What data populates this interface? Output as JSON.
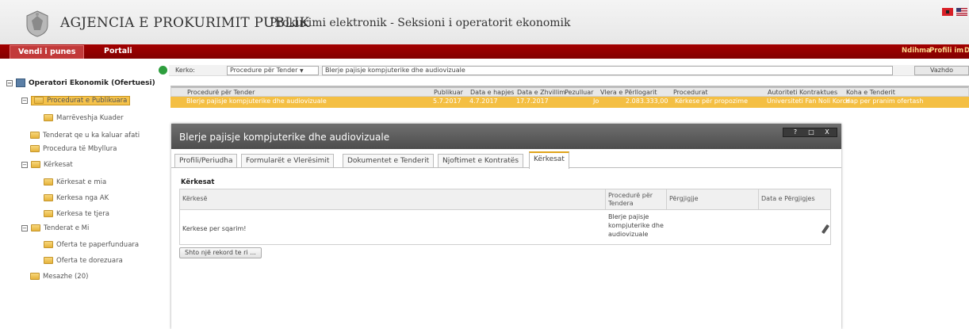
{
  "header": {
    "agency": "AGJENCIA E PROKURIMIT PUBLIK",
    "subtitle": "Prokurimi elektronik - Seksioni i operatorit ekonomik",
    "flags": [
      "albania-flag-icon",
      "us-flag-icon"
    ]
  },
  "nav": {
    "tabs": [
      "Vendi i punes",
      "Portali"
    ],
    "right": [
      "Ndihma",
      "Profili im",
      "D"
    ]
  },
  "sidebar": {
    "root": "Operatori Ekonomik (Ofertuesi)",
    "items": [
      "Procedurat e Publikuara",
      "Marrëveshja Kuader",
      "Tenderat qe u ka kaluar afati",
      "Procedura të Mbyllura",
      "Kërkesat",
      "Kërkesat e mia",
      "Kerkesa nga AK",
      "Kerkesa te tjera",
      "Tenderat e Mi",
      "Oferta te paperfunduara",
      "Oferta te dorezuara",
      "Mesazhe (20)"
    ]
  },
  "search": {
    "label": "Kerko:",
    "select": "Procedure për Tender",
    "select_arrow": "▼",
    "value": "Blerje pajisje kompjuterike dhe audiovizuale",
    "button": "Vazhdo"
  },
  "grid": {
    "columns": [
      "Procedurë për Tender",
      "Publikuar",
      "Data e hapjes",
      "Data e Zhvillim",
      "Pezulluar",
      "Vlera e Përllogarit",
      "Procedurat",
      "Autoriteti Kontraktues",
      "Koha e Tenderit"
    ],
    "row": [
      "Blerje pajisje kompjuterike dhe audiovizuale",
      "5.7.2017",
      "4.7.2017",
      "17.7.2017",
      "Jo",
      "2.083.333,00",
      "Kërkese për propozime",
      "Universiteti Fan Noli Korce",
      "Hap per pranim ofertash"
    ]
  },
  "modal": {
    "title": "Blerje pajisje kompjuterike dhe audiovizuale",
    "controls": [
      "?",
      "□",
      "X"
    ],
    "tabs": [
      "Profili/Periudha",
      "Formularët e Vlerësimit",
      "Dokumentet e Tenderit",
      "Njoftimet e Kontratës",
      "Kërkesat"
    ],
    "section_title": "Kërkesat",
    "table": {
      "headers": [
        "Kërkesë",
        "Procedurë për Tendera",
        "Përgjigjje",
        "Data e Përgjigjes"
      ],
      "row": {
        "request": "Kerkese per sqarim!",
        "procedure": "Blerje pajisje kompjuterike dhe audiovizuale",
        "answer": "",
        "date": ""
      }
    },
    "add_button": "Shto një rekord te ri ..."
  }
}
